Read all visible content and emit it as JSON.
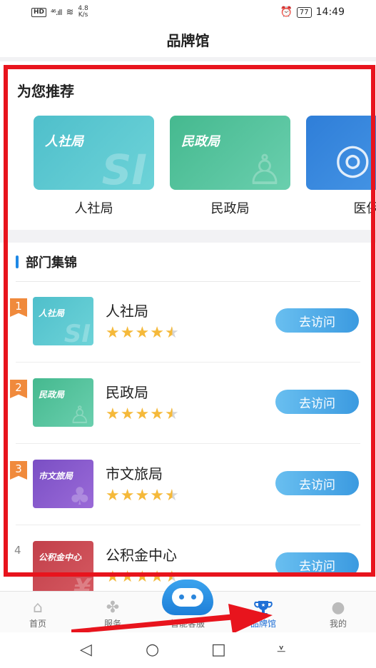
{
  "status_bar": {
    "hd": "HD",
    "signal": "⁴⁶.ıll",
    "speed": "4.8",
    "speed_unit": "K/s",
    "battery": "77",
    "time": "14:49"
  },
  "header": {
    "title": "品牌馆"
  },
  "recommend": {
    "title": "为您推荐",
    "items": [
      {
        "label": "人社局",
        "logo_text": "人社局",
        "deco": "SI",
        "color_a": "#4fbfcb",
        "color_b": "#5ccad3"
      },
      {
        "label": "民政局",
        "logo_text": "民政局",
        "deco": "♙",
        "color_a": "#45b98f",
        "color_b": "#5fcaa4"
      },
      {
        "label": "医保",
        "logo_text": "",
        "deco": "◎",
        "color_a": "#2f7ed8",
        "color_b": "#3b8fe4"
      }
    ]
  },
  "departments": {
    "title": "部门集锦",
    "items": [
      {
        "rank": "1",
        "name": "人社局",
        "thumb_text": "人社局",
        "thumb_deco": "SI",
        "color": "#4fbfcb",
        "rating": 4.5,
        "button": "去访问",
        "badge": true
      },
      {
        "rank": "2",
        "name": "民政局",
        "thumb_text": "民政局",
        "thumb_deco": "♙",
        "color": "#45b98f",
        "rating": 4.5,
        "button": "去访问",
        "badge": true
      },
      {
        "rank": "3",
        "name": "市文旅局",
        "thumb_text": "市文旅局",
        "thumb_deco": "♣",
        "color": "#7a4fc4",
        "rating": 4.5,
        "button": "去访问",
        "badge": true
      },
      {
        "rank": "4",
        "name": "公积金中心",
        "thumb_text": "公积金中心",
        "thumb_deco": "¥",
        "color": "#c2404a",
        "rating": 4.5,
        "button": "去访问",
        "badge": false
      }
    ]
  },
  "bottom_nav": {
    "items": [
      {
        "label": "首页",
        "icon": "home-icon",
        "glyph": "⌂"
      },
      {
        "label": "服务",
        "icon": "grid-icon",
        "glyph": "✤"
      },
      {
        "label": "智能客服",
        "icon": "robot-icon",
        "glyph": ""
      },
      {
        "label": "品牌馆",
        "icon": "trophy-icon",
        "glyph": "🏆"
      },
      {
        "label": "我的",
        "icon": "user-icon",
        "glyph": "●"
      }
    ],
    "active": "品牌馆",
    "accent": "#1e6fd6"
  },
  "system_nav": {
    "back": "◁",
    "home": "○",
    "recents": "□",
    "menu": "⩡"
  },
  "colors": {
    "highlight": "#e8141d",
    "star": "#f5b93a",
    "button": "#3b9ae0"
  }
}
